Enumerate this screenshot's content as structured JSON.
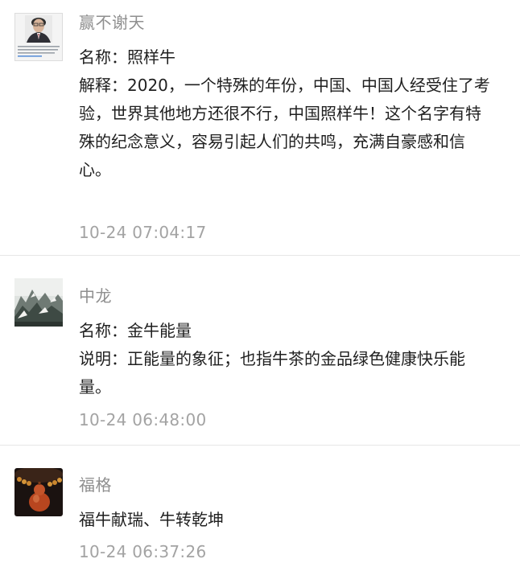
{
  "comments": [
    {
      "nickname": "赢不谢天",
      "avatar": "portrait-avatar",
      "lines": [
        "名称：照样牛",
        "解释：2020，一个特殊的年份，中国、中国人经受住了考",
        "验，世界其他地方还很不行，中国照样牛！这个名字有特",
        "殊的纪念意义，容易引起人们的共鸣，充满自豪感和信",
        "心。"
      ],
      "time": "10-24 07:04:17"
    },
    {
      "nickname": "中龙",
      "avatar": "mountain-painting-avatar",
      "lines": [
        "名称：金牛能量",
        "说明：正能量的象征；也指牛茶的金品绿色健康快乐能",
        "量。"
      ],
      "time": "10-24 06:48:00"
    },
    {
      "nickname": "福格",
      "avatar": "gourd-beads-avatar",
      "lines": [
        "福牛献瑞、牛转乾坤"
      ],
      "time": "10-24 06:37:26"
    }
  ]
}
